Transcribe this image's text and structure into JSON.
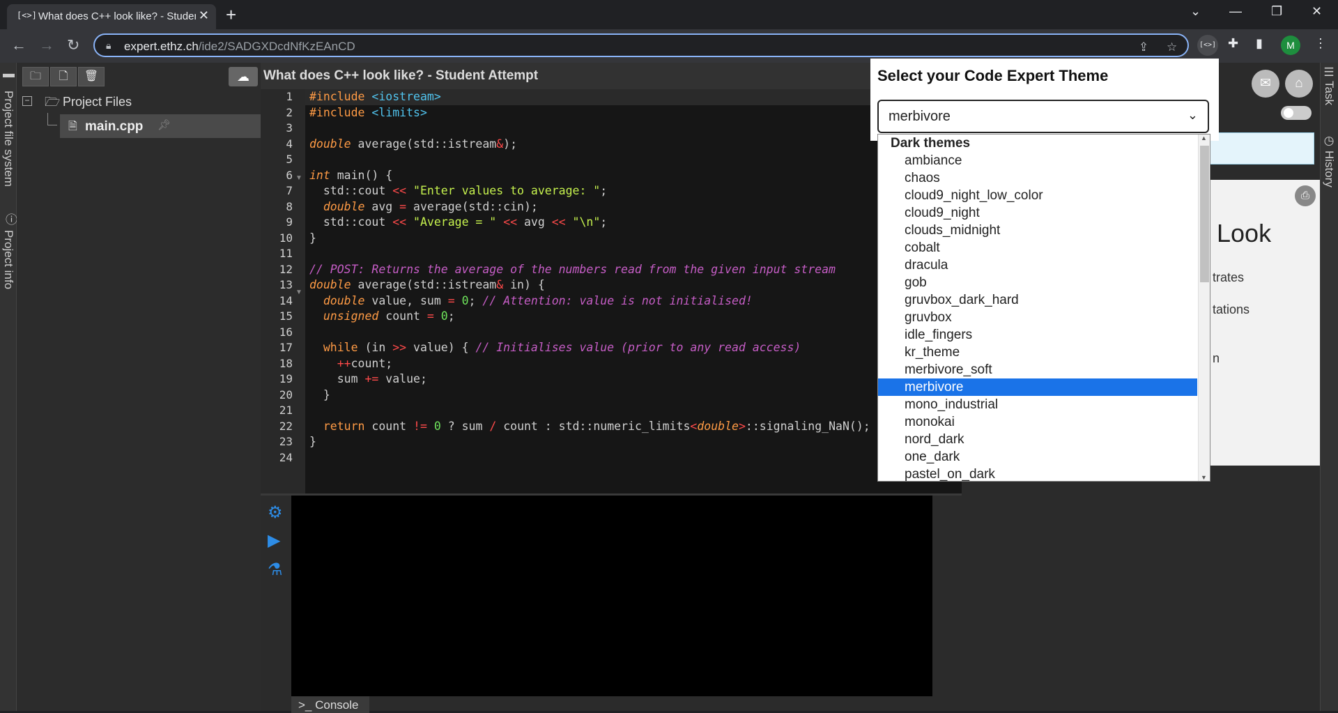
{
  "browser": {
    "tab_title": "What does C++ look like? - Student Attempt",
    "url_host": "expert.ethz.ch",
    "url_path": "/ide2/SADGXDcdNfKzEAnCD",
    "profile_initial": "M"
  },
  "sidebar_left": {
    "file_system_label": "Project file system",
    "info_label": "Project info"
  },
  "file_tree": {
    "root": "Project Files",
    "file": "main.cpp"
  },
  "editor": {
    "title": "What does C++ look like? - Student Attempt",
    "line_numbers": [
      "1",
      "2",
      "3",
      "4",
      "5",
      "6",
      "7",
      "8",
      "9",
      "10",
      "11",
      "12",
      "13",
      "14",
      "15",
      "16",
      "17",
      "18",
      "19",
      "20",
      "21",
      "22",
      "23",
      "24"
    ]
  },
  "console": {
    "tab_label": "Console"
  },
  "right_panel": {
    "heading_fragment": "Look",
    "text1": "trates",
    "text2": "tations",
    "text3": "n",
    "rail_task": "Task",
    "rail_history": "History"
  },
  "theme_popup": {
    "title": "Select your Code Expert Theme",
    "selected": "merbivore",
    "group_label": "Dark themes",
    "options": [
      "ambiance",
      "chaos",
      "cloud9_night_low_color",
      "cloud9_night",
      "clouds_midnight",
      "cobalt",
      "dracula",
      "gob",
      "gruvbox_dark_hard",
      "gruvbox",
      "idle_fingers",
      "kr_theme",
      "merbivore_soft",
      "merbivore",
      "mono_industrial",
      "monokai",
      "nord_dark",
      "one_dark",
      "pastel_on_dark"
    ],
    "selected_index": 13
  },
  "colors": {
    "accent": "#1a73e8",
    "keyword": "#ff9b45",
    "string": "#c6f24e",
    "comment": "#c65dc6",
    "include": "#51c5f0"
  }
}
